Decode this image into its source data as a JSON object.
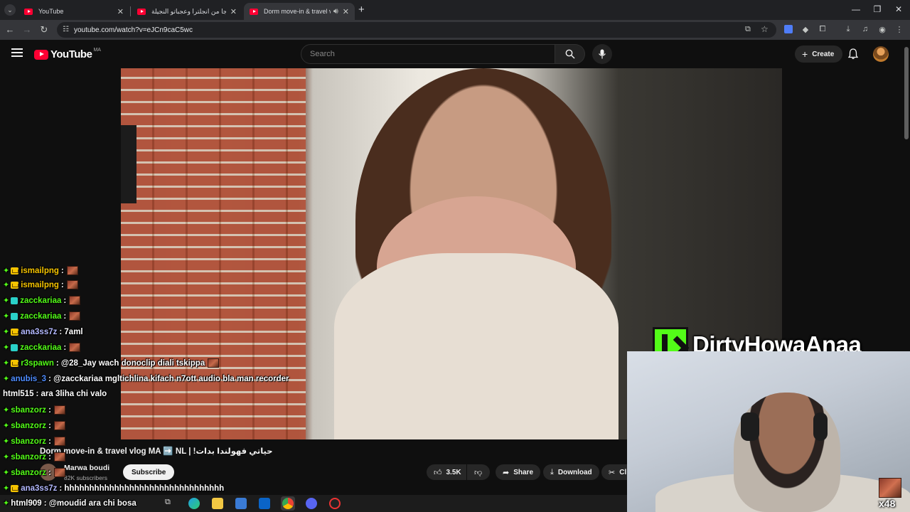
{
  "browser": {
    "tabs": [
      {
        "title": "YouTube",
        "active": false
      },
      {
        "title": "خويا جا من انجلترا وعجباتو النجيلة",
        "active": false
      },
      {
        "title": "Dorm move-in & travel vlog",
        "active": true
      }
    ],
    "url": "youtube.com/watch?v=eJCn9caC5wc"
  },
  "youtube": {
    "logo_text": "YouTube",
    "region_code": "MA",
    "search_placeholder": "Search",
    "create_label": "Create"
  },
  "video": {
    "title": "Dorm move-in & travel vlog MA ➡️ NL | !حياتي فهولندا بدات",
    "channel_name": "Marwa boudi",
    "subscribers": "82K subscribers",
    "subscribe_label": "Subscribe",
    "likes": "3.5K",
    "share_label": "Share",
    "download_label": "Download",
    "clip_label": "Cl"
  },
  "chat": [
    {
      "badges": [
        "g",
        "y"
      ],
      "user": "ismailpng",
      "color": "#f5c400",
      "msg": ":",
      "emote": true
    },
    {
      "badges": [
        "g",
        "y"
      ],
      "user": "ismailpng",
      "color": "#f5c400",
      "msg": ":",
      "emote": true
    },
    {
      "badges": [
        "g",
        "c"
      ],
      "user": "zacckariaa",
      "color": "#53fc18",
      "msg": ":",
      "emote": true
    },
    {
      "badges": [
        "g",
        "c"
      ],
      "user": "zacckariaa",
      "color": "#53fc18",
      "msg": ":",
      "emote": true
    },
    {
      "badges": [
        "g",
        "y"
      ],
      "user": "ana3ss7z",
      "color": "#b3b9ff",
      "msg": ": 7aml",
      "emote": false
    },
    {
      "badges": [
        "g",
        "c"
      ],
      "user": "zacckariaa",
      "color": "#53fc18",
      "msg": ":",
      "emote": true
    },
    {
      "badges": [
        "g",
        "y"
      ],
      "user": "r3spawn",
      "color": "#53fc18",
      "msg": ": @28_Jay wach donoclip diali tskippa",
      "emote": true
    },
    {
      "badges": [
        "g"
      ],
      "user": "anubis_3",
      "color": "#4f8dff",
      "msg": ": @zacckariaa mgltichlina kifach n7ott audio bla man recorder",
      "emote": false
    },
    {
      "badges": [],
      "user": "html515",
      "color": "#ffffff",
      "msg": ": ara 3liha chi valo",
      "emote": false
    },
    {
      "badges": [
        "g"
      ],
      "user": "sbanzorz",
      "color": "#53fc18",
      "msg": ":",
      "emote": true
    },
    {
      "badges": [
        "g"
      ],
      "user": "sbanzorz",
      "color": "#53fc18",
      "msg": ":",
      "emote": true
    },
    {
      "badges": [
        "g"
      ],
      "user": "sbanzorz",
      "color": "#53fc18",
      "msg": ":",
      "emote": true
    },
    {
      "badges": [
        "g"
      ],
      "user": "sbanzorz",
      "color": "#53fc18",
      "msg": ":",
      "emote": true
    },
    {
      "badges": [
        "g"
      ],
      "user": "sbanzorz",
      "color": "#53fc18",
      "msg": ":",
      "emote": true
    },
    {
      "badges": [
        "g",
        "y"
      ],
      "user": "ana3ss7z",
      "color": "#b3b9ff",
      "msg": ": hhhhhhhhhhhhhhhhhhhhhhhhhhhhhhhh",
      "emote": false
    },
    {
      "badges": [
        "g"
      ],
      "user": "html909",
      "color": "#ffffff",
      "msg": ": @moudid ara chi bosa",
      "emote": false
    }
  ],
  "stream": {
    "streamer_name": "DirtyHowaAnaa",
    "combo_count": "x48"
  }
}
